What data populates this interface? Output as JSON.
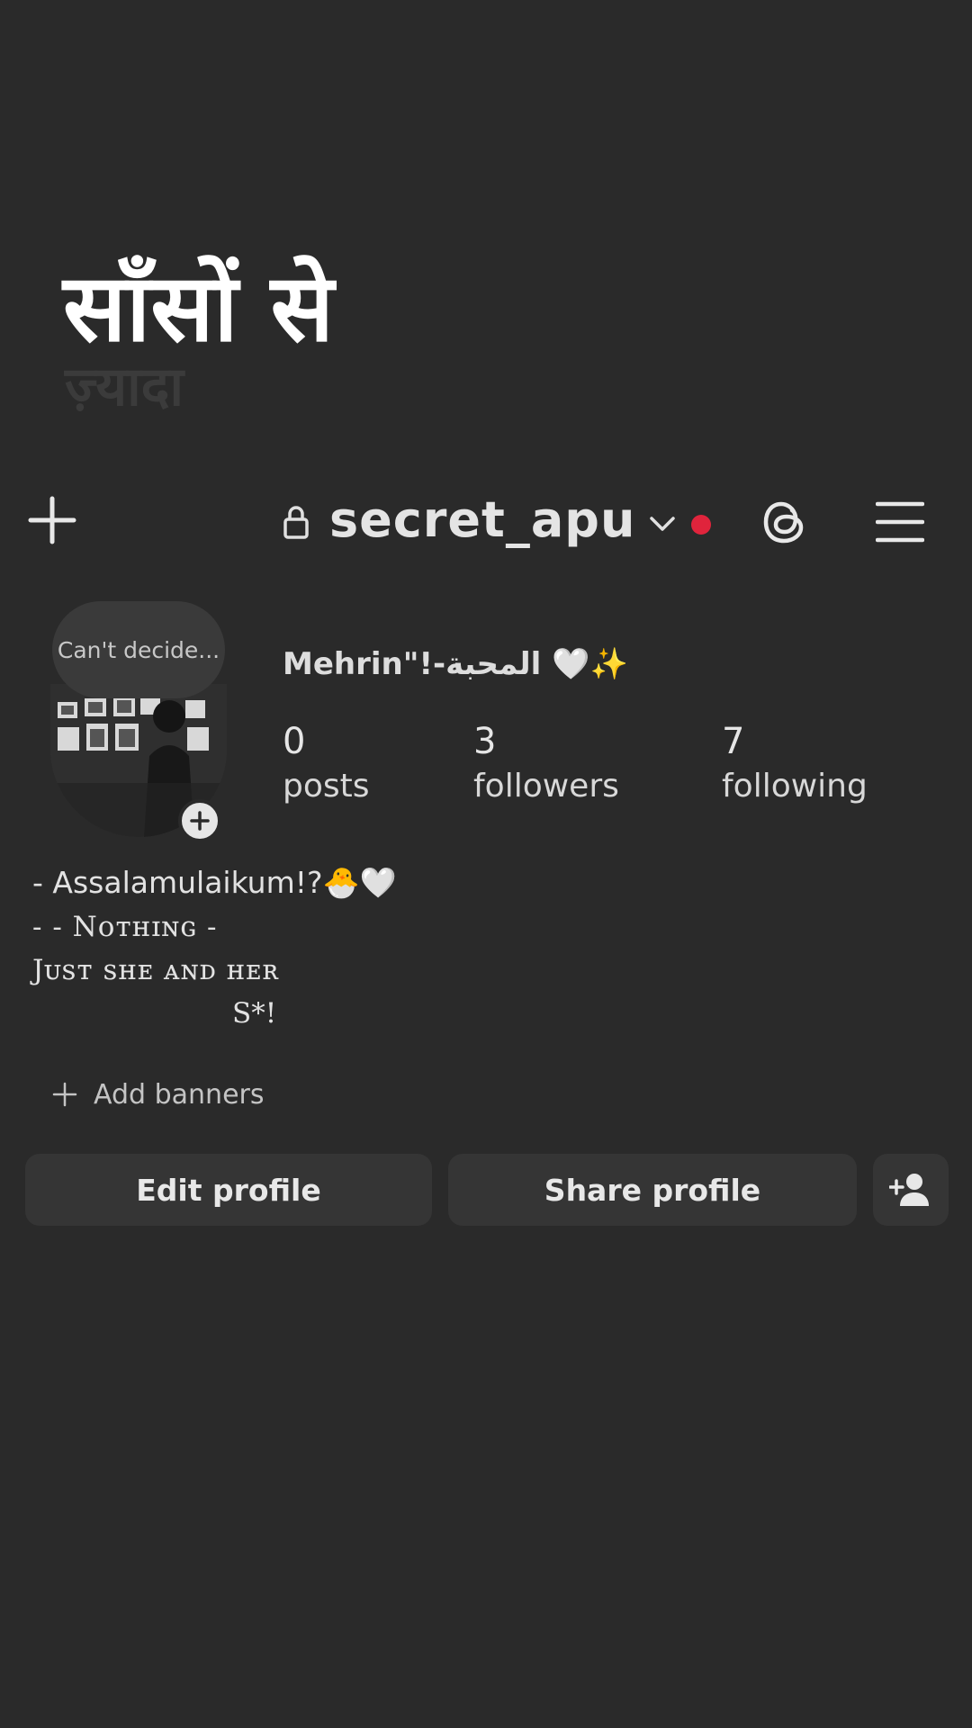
{
  "overlay": {
    "hindi_text": "साँसों से",
    "ghost_text": "ज़्यादा"
  },
  "header": {
    "username": "secret_apu",
    "icons": [
      "plus-icon",
      "lock-icon",
      "chevron-down-icon",
      "threads-icon",
      "menu-icon"
    ],
    "notification_dot_color": "#e0243c"
  },
  "profile": {
    "note": "Can't decide...",
    "display_name": "Mehrin\"!-المحبة 🤍✨",
    "stats": {
      "posts": {
        "count": "0",
        "label": "posts"
      },
      "followers": {
        "count": "3",
        "label": "followers"
      },
      "following": {
        "count": "7",
        "label": "following"
      }
    },
    "bio": {
      "line1": "- Assalamulaikum!?🐣🤍",
      "line2": "- - Nᴏᴛʜɪɴɢ -",
      "line3": "Jᴜsᴛ sʜᴇ ᴀɴᴅ ʜᴇʀ",
      "line4": "S*!"
    },
    "add_banners_label": "Add banners"
  },
  "actions": {
    "edit_profile": "Edit profile",
    "share_profile": "Share profile"
  }
}
